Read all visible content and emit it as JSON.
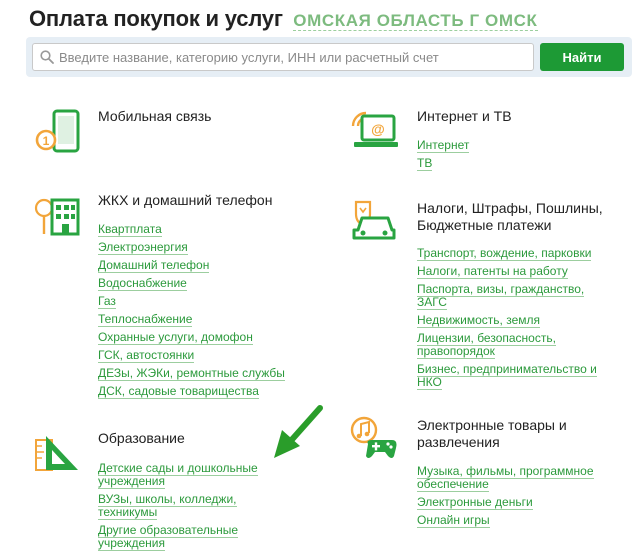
{
  "header": {
    "title": "Оплата покупок и услуг",
    "region": "ОМСКАЯ ОБЛАСТЬ Г ОМСК"
  },
  "search": {
    "placeholder": "Введите название, категорию услуги, ИНН или расчетный счет",
    "button_label": "Найти"
  },
  "colors": {
    "green": "#1d9a35",
    "link": "#2c9a3c",
    "orange": "#f2a53a"
  },
  "categories": {
    "mobile": {
      "title": "Мобильная связь",
      "icon": "mobile-phone-icon",
      "links": []
    },
    "internet": {
      "title": "Интернет и ТВ",
      "icon": "laptop-wifi-icon",
      "links": [
        "Интернет",
        "ТВ"
      ]
    },
    "housing": {
      "title": "ЖКХ и домашний телефон",
      "icon": "house-tree-icon",
      "links": [
        "Квартплата",
        "Электроэнергия",
        "Домашний телефон",
        "Водоснабжение",
        "Газ",
        "Теплоснабжение",
        "Охранные услуги, домофон",
        "ГСК, автостоянки",
        "ДЕЗы, ЖЭКи, ремонтные службы",
        "ДСК, садовые товарищества"
      ]
    },
    "taxes": {
      "title_line1": "Налоги, Штрафы, Пошлины,",
      "title_line2": "Бюджетные платежи",
      "icon": "emblem-car-icon",
      "links": [
        "Транспорт, вождение, парковки",
        "Налоги, патенты на работу",
        "Паспорта, визы, гражданство,",
        "ЗАГС",
        "Недвижимость, земля",
        "Лицензии, безопасность,",
        "правопорядок",
        "Бизнес, предпринимательство и",
        "НКО"
      ]
    },
    "education": {
      "title": "Образование",
      "icon": "ruler-triangle-icon",
      "links": [
        "Детские сады и дошкольные",
        "учреждения",
        "ВУЗы, школы, колледжи,",
        "техникумы",
        "Другие образовательные",
        "учреждения"
      ]
    },
    "entertainment": {
      "title_line1": "Электронные товары и",
      "title_line2": "развлечения",
      "icon": "music-gamepad-icon",
      "links": [
        "Музыка, фильмы, программное",
        "обеспечение",
        "Электронные деньги",
        "Онлайн игры"
      ]
    }
  }
}
